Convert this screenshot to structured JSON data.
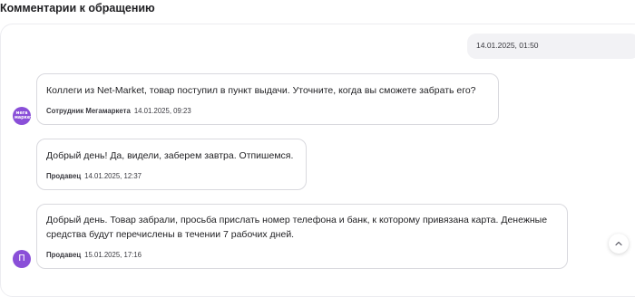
{
  "section_title": "Комментарии к обращению",
  "colors": {
    "avatar": "#8a4fd8",
    "own_message_bg": "#f2f2f5",
    "bubble_border": "#d9d9de"
  },
  "own_message": {
    "time": "14.01.2025, 01:50"
  },
  "messages": [
    {
      "text": "Коллеги из Net-Market, товар поступил в пункт выдачи. Уточните, когда вы сможете забрать его?",
      "author": "Сотрудник Мегамаркета",
      "time": "14.01.2025, 09:23",
      "avatar": "мега маркет"
    },
    {
      "text": "Добрый день! Да, видели, заберем завтра. Отпишемся.",
      "author": "Продавец",
      "time": "14.01.2025, 12:37"
    },
    {
      "text": "Добрый день. Товар забрали, просьба прислать номер телефона и банк, к которому привязана карта. Денежные средства будут перечислены в течении 7 рабочих дней.",
      "author": "Продавец",
      "time": "15.01.2025, 17:16",
      "avatar": "П"
    }
  ],
  "scroll_button_icon": "chevron-up-icon"
}
